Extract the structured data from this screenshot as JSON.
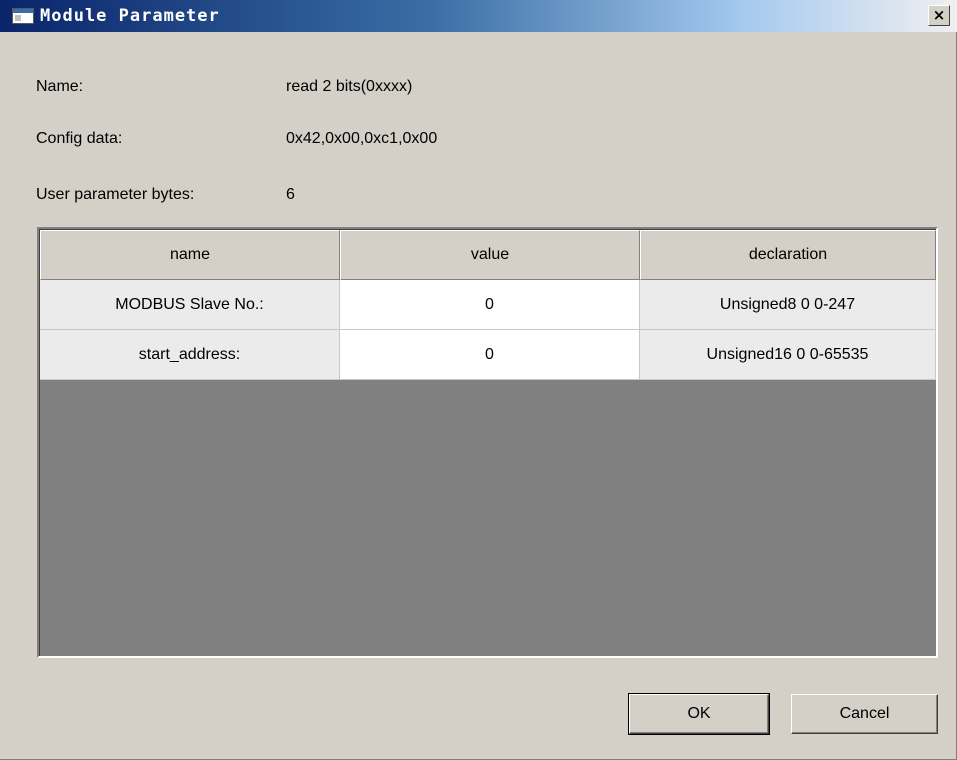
{
  "window": {
    "title": "Module Parameter",
    "close_label": "×"
  },
  "info": {
    "name_label": "Name:",
    "name_value": "read 2 bits(0xxxx)",
    "config_label": "Config data:",
    "config_value": "0x42,0x00,0xc1,0x00",
    "user_param_label": "User parameter bytes:",
    "user_param_value": "6"
  },
  "table": {
    "columns": [
      "name",
      "value",
      "declaration"
    ],
    "rows": [
      {
        "name": "MODBUS Slave No.:",
        "value": "0",
        "declaration": "Unsigned8 0 0-247"
      },
      {
        "name": "start_address:",
        "value": "0",
        "declaration": "Unsigned16 0 0-65535"
      }
    ]
  },
  "buttons": {
    "ok": "OK",
    "cancel": "Cancel"
  },
  "icons": {
    "window": "window-icon",
    "close": "close-icon"
  }
}
